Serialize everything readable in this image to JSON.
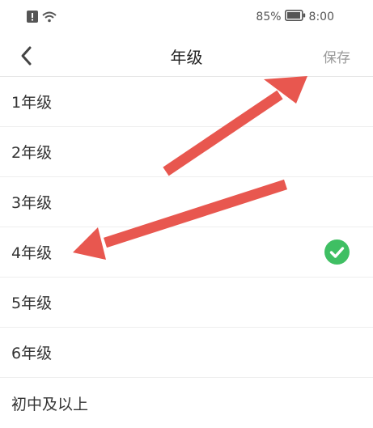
{
  "status_bar": {
    "battery_percent": "85%",
    "time": "8:00"
  },
  "header": {
    "title": "年级",
    "save_label": "保存"
  },
  "grades": [
    {
      "label": "1年级",
      "selected": false
    },
    {
      "label": "2年级",
      "selected": false
    },
    {
      "label": "3年级",
      "selected": false
    },
    {
      "label": "4年级",
      "selected": true
    },
    {
      "label": "5年级",
      "selected": false
    },
    {
      "label": "6年级",
      "selected": false
    },
    {
      "label": "初中及以上",
      "selected": false
    }
  ],
  "colors": {
    "check_green": "#3fbf63",
    "annotation_red": "#e8574f"
  }
}
